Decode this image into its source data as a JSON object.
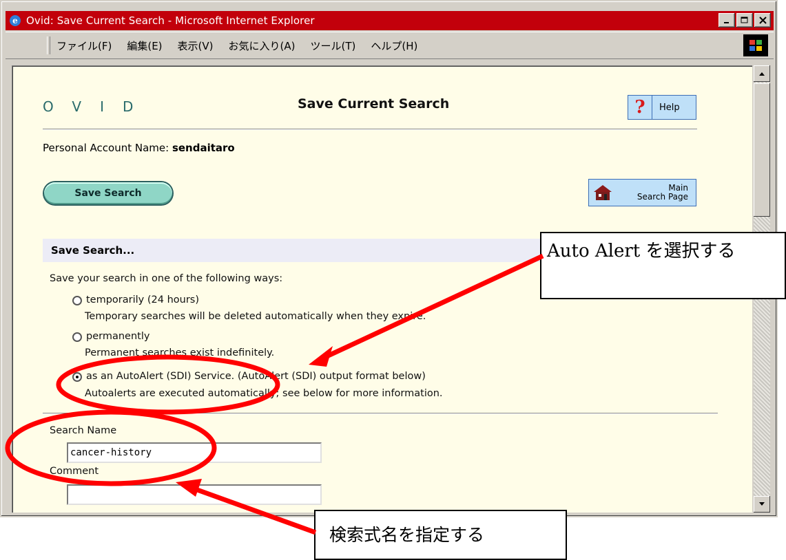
{
  "window": {
    "title": "Ovid: Save Current Search - Microsoft Internet Explorer"
  },
  "menu": [
    "ファイル(F)",
    "編集(E)",
    "表示(V)",
    "お気に入り(A)",
    "ツール(T)",
    "ヘルプ(H)"
  ],
  "header": {
    "logo": "OVID",
    "title": "Save Current Search",
    "help_label": "Help",
    "help_glyph": "?"
  },
  "account": {
    "label": "Personal Account Name:",
    "name": "sendaitaro"
  },
  "buttons": {
    "save_search": "Save Search",
    "main_search_line1": "Main",
    "main_search_line2": "Search Page"
  },
  "save_section": {
    "heading": "Save Search...",
    "intro": "Save your search in one of the following ways:",
    "options": [
      {
        "label": "temporarily (24 hours)",
        "desc": "Temporary searches will be deleted automatically when they expire.",
        "checked": false
      },
      {
        "label": "permanently",
        "desc": "Permanent searches exist indefinitely.",
        "checked": false
      },
      {
        "label": "as an AutoAlert (SDI) Service. (AutoAlert (SDI) output format below)",
        "desc": "Autoalerts are executed automatically; see below for more information.",
        "checked": true
      }
    ]
  },
  "form": {
    "search_name_label": "Search Name",
    "search_name_value": "cancer-history",
    "comment_label": "Comment",
    "comment_value": ""
  },
  "annotations": {
    "autoalert_callout": "Auto Alert を選択する",
    "name_callout": "検索式名を指定する",
    "accent_color": "#ff0000"
  }
}
